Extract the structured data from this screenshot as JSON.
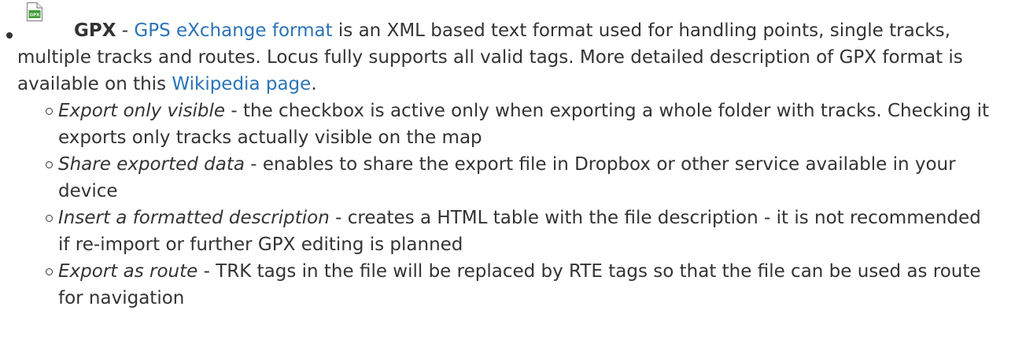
{
  "item": {
    "icon": "gpx-file-icon",
    "icon_label": "GPX",
    "title": "GPX",
    "sep": " - ",
    "link1": "GPS eXchange format",
    "text1": " is an XML based text format used for handling points, single tracks, multiple tracks and routes. Locus fully supports all valid tags. More detailed description of GPX format is available on this ",
    "link2": "Wikipedia page",
    "text2": "."
  },
  "options": [
    {
      "name": "Export only visible",
      "desc": " - the checkbox is active only when exporting a whole folder with tracks. Checking it exports only tracks actually visible on the map"
    },
    {
      "name": "Share exported data",
      "desc": " - enables to share the export file in Dropbox or other service available in your device"
    },
    {
      "name": "Insert a formatted description",
      "desc": " - creates a HTML table with the file description - it is not recommended if re-import or further GPX editing is planned"
    },
    {
      "name": "Export as route",
      "desc": " - TRK tags in the file will be replaced by RTE tags so that the file can be used as route for navigation"
    }
  ],
  "colors": {
    "text": "#333333",
    "link": "#2b73b7",
    "icon_green": "#3f9b35"
  }
}
